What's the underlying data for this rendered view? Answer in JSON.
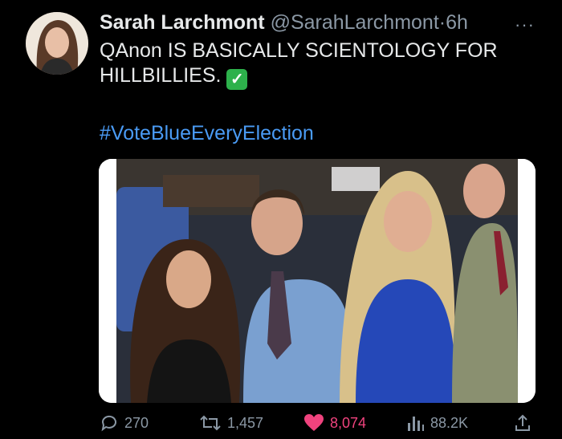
{
  "tweet": {
    "author_name": "Sarah Larchmont",
    "handle": "@SarahLarchmont",
    "separator": "·",
    "time": "6h",
    "more": "···",
    "text": "QAnon IS BASICALLY SCIENTOLOGY FOR HILLBILLIES.",
    "check_glyph": "✓",
    "hashtag": "#VoteBlueEveryElection"
  },
  "actions": {
    "replies": "270",
    "retweets": "1,457",
    "likes": "8,074",
    "views": "88.2K"
  },
  "colors": {
    "background": "#000000",
    "text": "#e7e9ea",
    "muted": "#8b98a5",
    "link": "#4a9bf5",
    "like": "#f0437e",
    "check": "#2db14b"
  },
  "icons": [
    "reply-icon",
    "retweet-icon",
    "heart-icon",
    "views-icon",
    "share-icon",
    "more-icon",
    "check-icon"
  ]
}
